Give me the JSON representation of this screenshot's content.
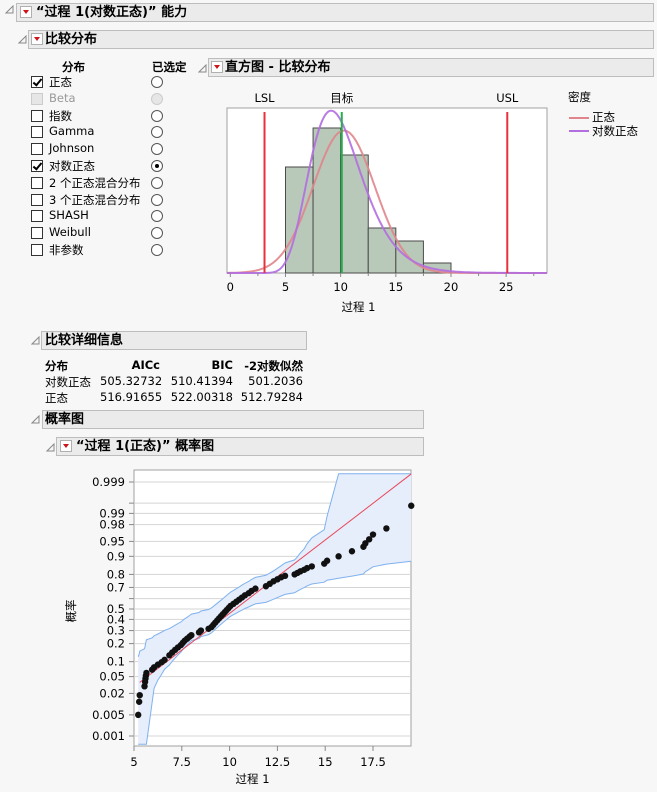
{
  "report": {
    "title": "“过程 1(对数正态)” 能力",
    "compare": {
      "title": "比较分布",
      "col_distribution": "分布",
      "col_selected": "已选定",
      "items": [
        {
          "label": "正态",
          "checked": true,
          "selected": false,
          "disabled": false
        },
        {
          "label": "Beta",
          "checked": false,
          "selected": false,
          "disabled": true
        },
        {
          "label": "指数",
          "checked": false,
          "selected": false,
          "disabled": false
        },
        {
          "label": "Gamma",
          "checked": false,
          "selected": false,
          "disabled": false
        },
        {
          "label": "Johnson",
          "checked": false,
          "selected": false,
          "disabled": false
        },
        {
          "label": "对数正态",
          "checked": true,
          "selected": true,
          "disabled": false
        },
        {
          "label": "2 个正态混合分布",
          "checked": false,
          "selected": false,
          "disabled": false
        },
        {
          "label": "3 个正态混合分布",
          "checked": false,
          "selected": false,
          "disabled": false
        },
        {
          "label": "SHASH",
          "checked": false,
          "selected": false,
          "disabled": false
        },
        {
          "label": "Weibull",
          "checked": false,
          "selected": false,
          "disabled": false
        },
        {
          "label": "非参数",
          "checked": false,
          "selected": false,
          "disabled": false
        }
      ]
    },
    "histogram": {
      "title": "直方图 - 比较分布",
      "legend_title": "密度",
      "legend": [
        {
          "label": "正态",
          "color": "#e0858c"
        },
        {
          "label": "对数正态",
          "color": "#b36ee0"
        }
      ]
    },
    "details": {
      "title": "比较详细信息",
      "headers": [
        "分布",
        "AICc",
        "BIC",
        "-2对数似然"
      ],
      "rows": [
        [
          "对数正态",
          "505.32732",
          "510.41394",
          "501.2036"
        ],
        [
          "正态",
          "516.91655",
          "522.00318",
          "512.79284"
        ]
      ]
    },
    "prob_section": {
      "title": "概率图"
    },
    "prob_plot": {
      "title": "“过程 1(正态)” 概率图"
    }
  },
  "chart_data": [
    {
      "type": "bar",
      "title": "直方图 - 比较分布",
      "xlabel": "过程 1",
      "ylabel": "",
      "xlim": [
        -0.3,
        28.7
      ],
      "xticks": [
        0,
        5,
        10,
        15,
        20,
        25
      ],
      "bins": [
        {
          "from": 5,
          "to": 7.5,
          "density": 0.106
        },
        {
          "from": 7.5,
          "to": 10,
          "density": 0.145
        },
        {
          "from": 10,
          "to": 12.5,
          "density": 0.118
        },
        {
          "from": 12.5,
          "to": 15,
          "density": 0.045
        },
        {
          "from": 15,
          "to": 17.5,
          "density": 0.032
        },
        {
          "from": 17.5,
          "to": 20,
          "density": 0.01
        }
      ],
      "ymax": 0.165,
      "spec_limits": [
        {
          "label": "LSL",
          "value": 3.1,
          "color": "#e8313b"
        },
        {
          "label": "目标",
          "value": 10.1,
          "color": "#22b04a"
        },
        {
          "label": "USL",
          "value": 25.1,
          "color": "#e8313b"
        }
      ],
      "series": [
        {
          "name": "正态",
          "dist": "normal",
          "mean": 10.3,
          "sd": 2.8,
          "color": "#e0858c"
        },
        {
          "name": "对数正态",
          "dist": "lognormal",
          "mu": 2.28,
          "sigma": 0.26,
          "color": "#b36ee0"
        }
      ],
      "legend_title": "密度",
      "legend_position": "right"
    },
    {
      "type": "scatter",
      "title": "“过程 1(正态)” 概率图",
      "xlabel": "过程 1",
      "ylabel": "概率",
      "xlim": [
        5,
        19.5
      ],
      "xticks": [
        5,
        7.5,
        10,
        12.5,
        15,
        17.5
      ],
      "yticks": [
        0.001,
        0.005,
        0.02,
        0.05,
        0.1,
        0.2,
        0.3,
        0.4,
        0.5,
        0.7,
        0.8,
        0.9,
        0.95,
        0.98,
        0.99,
        0.999
      ],
      "fit_line": {
        "mean": 10.3,
        "sd": 2.8,
        "color": "#e8485a"
      },
      "band_color": "#7fb2ee",
      "points": [
        [
          5.22,
          0.005
        ],
        [
          5.27,
          0.012
        ],
        [
          5.3,
          0.018
        ],
        [
          5.55,
          0.03
        ],
        [
          5.58,
          0.038
        ],
        [
          5.6,
          0.045
        ],
        [
          5.62,
          0.052
        ],
        [
          5.65,
          0.06
        ],
        [
          5.95,
          0.07
        ],
        [
          6.05,
          0.078
        ],
        [
          6.25,
          0.088
        ],
        [
          6.45,
          0.098
        ],
        [
          6.6,
          0.108
        ],
        [
          6.85,
          0.13
        ],
        [
          7.0,
          0.145
        ],
        [
          7.15,
          0.16
        ],
        [
          7.3,
          0.175
        ],
        [
          7.45,
          0.19
        ],
        [
          7.55,
          0.205
        ],
        [
          7.65,
          0.22
        ],
        [
          7.78,
          0.235
        ],
        [
          7.9,
          0.25
        ],
        [
          8.0,
          0.262
        ],
        [
          8.4,
          0.285
        ],
        [
          8.5,
          0.3
        ],
        [
          8.9,
          0.315
        ],
        [
          9.05,
          0.33
        ],
        [
          9.15,
          0.35
        ],
        [
          9.25,
          0.37
        ],
        [
          9.35,
          0.39
        ],
        [
          9.45,
          0.41
        ],
        [
          9.55,
          0.43
        ],
        [
          9.65,
          0.45
        ],
        [
          9.75,
          0.47
        ],
        [
          9.85,
          0.49
        ],
        [
          9.95,
          0.51
        ],
        [
          10.05,
          0.53
        ],
        [
          10.2,
          0.55
        ],
        [
          10.35,
          0.57
        ],
        [
          10.5,
          0.59
        ],
        [
          10.65,
          0.61
        ],
        [
          10.8,
          0.63
        ],
        [
          11.0,
          0.65
        ],
        [
          11.15,
          0.67
        ],
        [
          11.35,
          0.69
        ],
        [
          11.9,
          0.71
        ],
        [
          12.1,
          0.73
        ],
        [
          12.3,
          0.75
        ],
        [
          12.5,
          0.765
        ],
        [
          12.7,
          0.78
        ],
        [
          12.9,
          0.79
        ],
        [
          13.4,
          0.8
        ],
        [
          13.55,
          0.81
        ],
        [
          13.7,
          0.82
        ],
        [
          13.9,
          0.83
        ],
        [
          14.05,
          0.84
        ],
        [
          14.3,
          0.85
        ],
        [
          14.95,
          0.865
        ],
        [
          15.1,
          0.88
        ],
        [
          15.7,
          0.9
        ],
        [
          16.4,
          0.92
        ],
        [
          17.0,
          0.935
        ],
        [
          17.1,
          0.945
        ],
        [
          17.3,
          0.955
        ],
        [
          17.5,
          0.965
        ],
        [
          18.2,
          0.975
        ],
        [
          19.5,
          0.994
        ]
      ]
    }
  ]
}
